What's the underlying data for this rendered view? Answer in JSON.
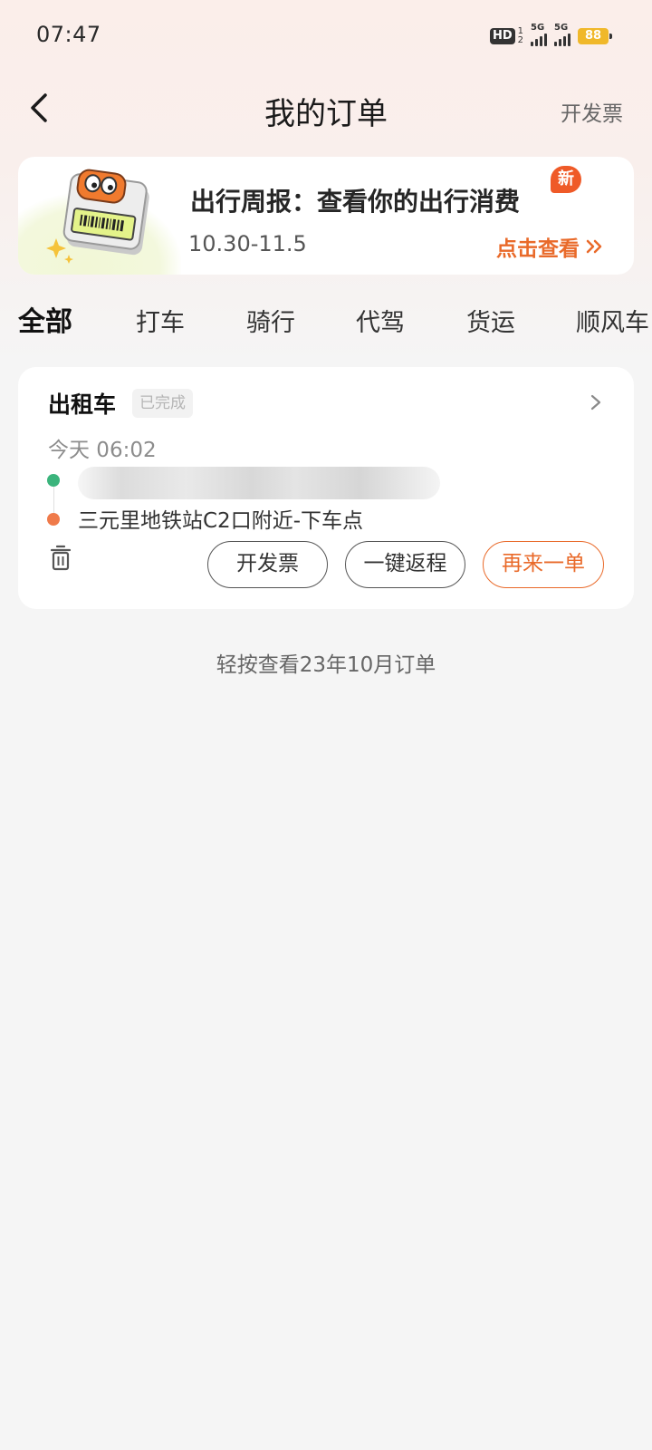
{
  "status_bar": {
    "time": "07:47",
    "hd_label": "HD",
    "hd_sub_top": "1",
    "hd_sub_bottom": "2",
    "signal_1_label": "5G",
    "signal_2_label": "5G",
    "battery": "88"
  },
  "header": {
    "title": "我的订单",
    "invoice_label": "开发票"
  },
  "report_banner": {
    "title": "出行周报：查看你的出行消费",
    "badge": "新",
    "date_range": "10.30-11.5",
    "action_label": "点击查看"
  },
  "tabs": [
    {
      "label": "全部",
      "active": true
    },
    {
      "label": "打车",
      "active": false
    },
    {
      "label": "骑行",
      "active": false
    },
    {
      "label": "代驾",
      "active": false
    },
    {
      "label": "货运",
      "active": false
    },
    {
      "label": "顺风车",
      "active": false
    }
  ],
  "order": {
    "type": "出租车",
    "status": "已完成",
    "time": "今天 06:02",
    "pickup": "",
    "dropoff": "三元里地铁站C2口附近-下车点",
    "buttons": {
      "invoice": "开发票",
      "return_trip": "一键返程",
      "reorder": "再来一单"
    }
  },
  "footer": {
    "history_link": "轻按查看23年10月订单"
  },
  "colors": {
    "accent": "#e96a2a",
    "badge_orange": "#ef5a28",
    "start_dot": "#3bb47c",
    "end_dot": "#ef7a4a"
  }
}
